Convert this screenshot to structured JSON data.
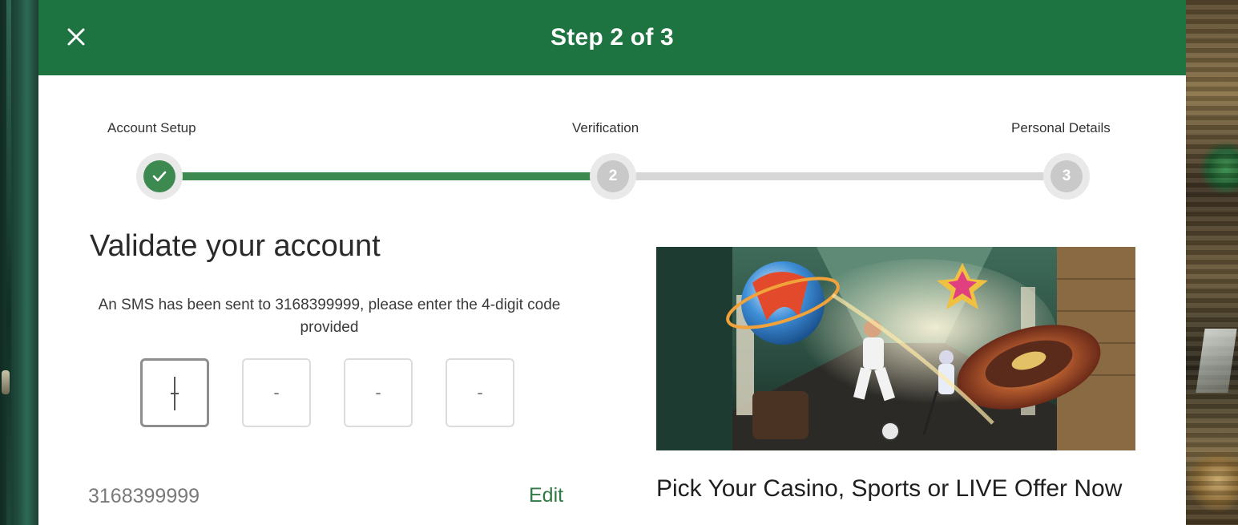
{
  "header": {
    "title": "Step 2 of 3",
    "close_icon": "close-icon",
    "background": "#1d7441"
  },
  "stepper": {
    "steps": [
      {
        "label": "Account Setup",
        "state": "complete",
        "marker": "✓"
      },
      {
        "label": "Verification",
        "state": "current",
        "marker": "2"
      },
      {
        "label": "Personal Details",
        "state": "upcoming",
        "marker": "3"
      }
    ],
    "complete_color": "#3c8a4f",
    "pending_color": "#c9c9c9"
  },
  "form": {
    "heading": "Validate your account",
    "sms_message": "An SMS has been sent to 3168399999, please enter the 4-digit code provided",
    "code_placeholders": [
      "",
      "-",
      "-",
      "-"
    ],
    "phone_number": "3168399999",
    "edit_label": "Edit"
  },
  "promo": {
    "image_alt": "casino-sports-live-promo-image",
    "title": "Pick Your Casino, Sports or LIVE Offer Now"
  }
}
